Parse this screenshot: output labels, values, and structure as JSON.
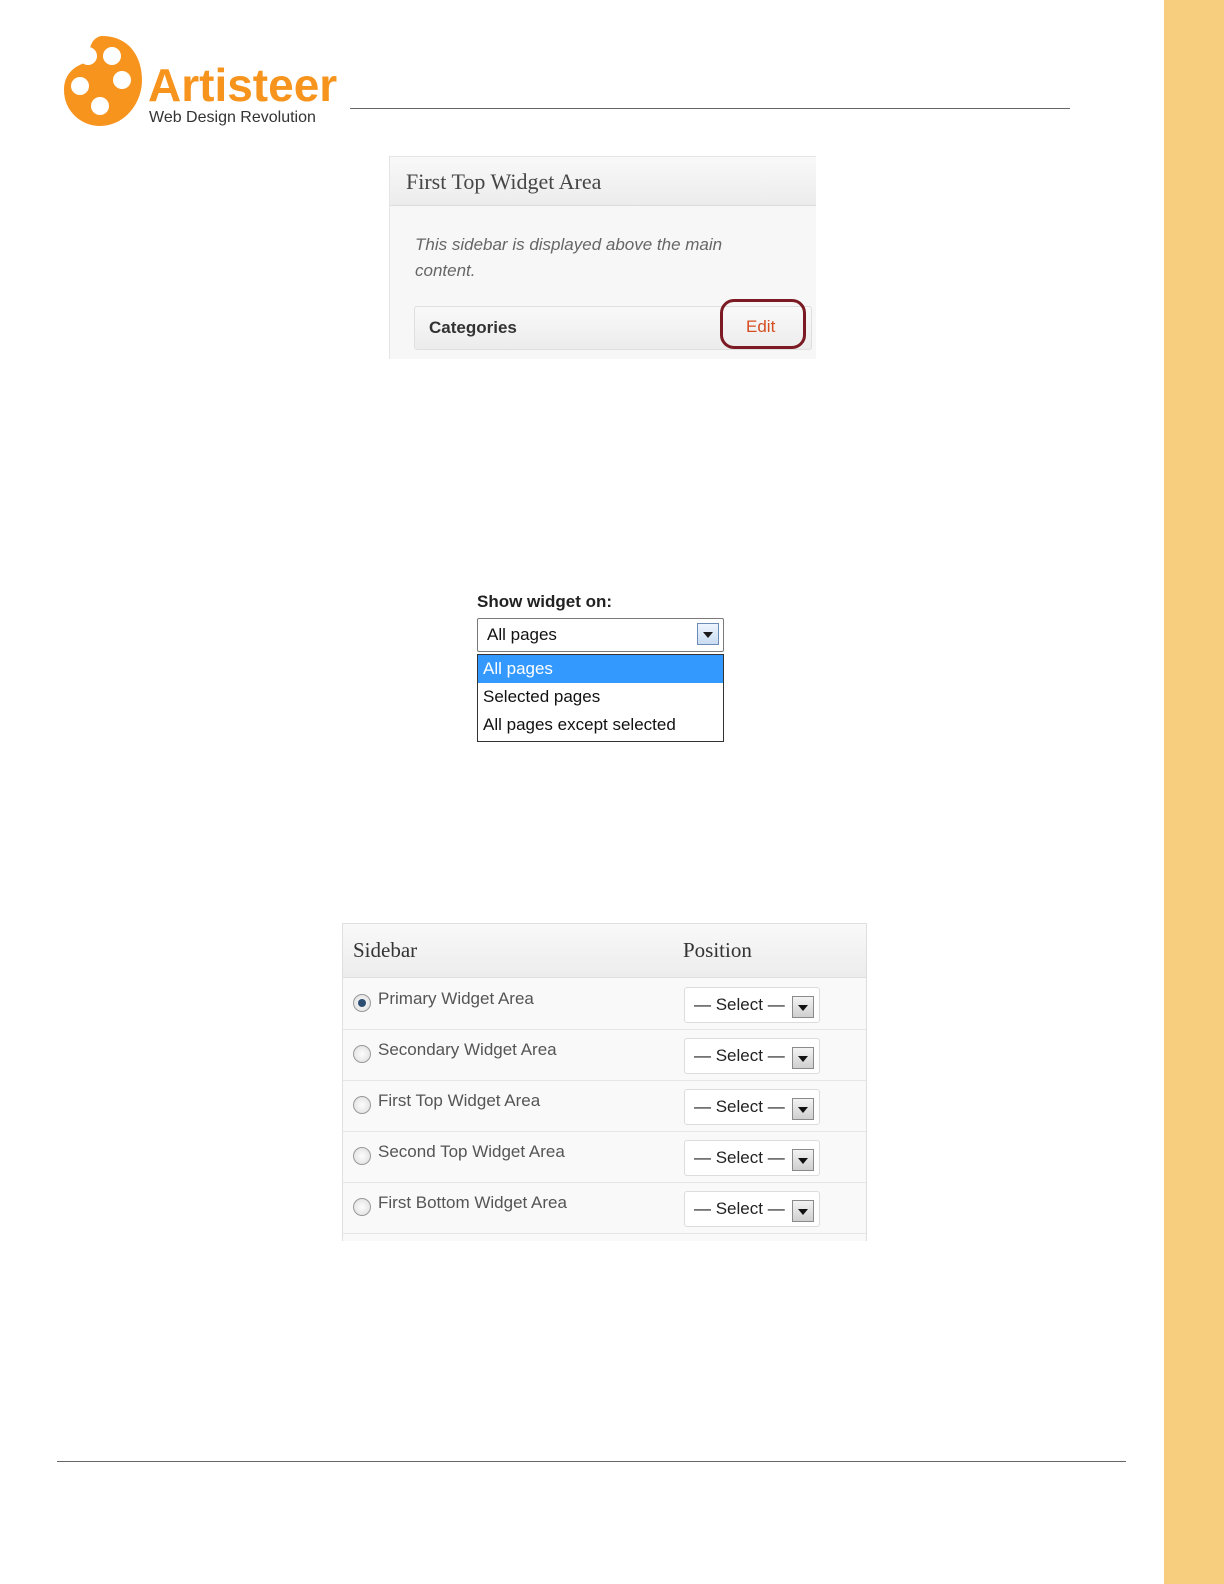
{
  "page": {
    "accent_color": "#f7941e",
    "band_color": "#f7cd7e"
  },
  "logo": {
    "name": "Artisteer",
    "tagline": "Web Design Revolution"
  },
  "widget_area_panel": {
    "title": "First Top Widget Area",
    "description": "This sidebar is displayed above the main content.",
    "widget_name": "Categories",
    "edit_label": "Edit"
  },
  "show_widget": {
    "label": "Show widget on:",
    "selected": "All pages",
    "options": [
      "All pages",
      "Selected pages",
      "All pages except selected"
    ]
  },
  "sidebar_table": {
    "headers": {
      "sidebar": "Sidebar",
      "position": "Position"
    },
    "rows": [
      {
        "label": "Primary Widget Area",
        "position": "— Select —",
        "checked": true
      },
      {
        "label": "Secondary Widget Area",
        "position": "— Select —",
        "checked": false
      },
      {
        "label": "First Top Widget Area",
        "position": "— Select —",
        "checked": false
      },
      {
        "label": "Second Top Widget Area",
        "position": "— Select —",
        "checked": false
      },
      {
        "label": "First Bottom Widget Area",
        "position": "— Select —",
        "checked": false
      }
    ]
  }
}
